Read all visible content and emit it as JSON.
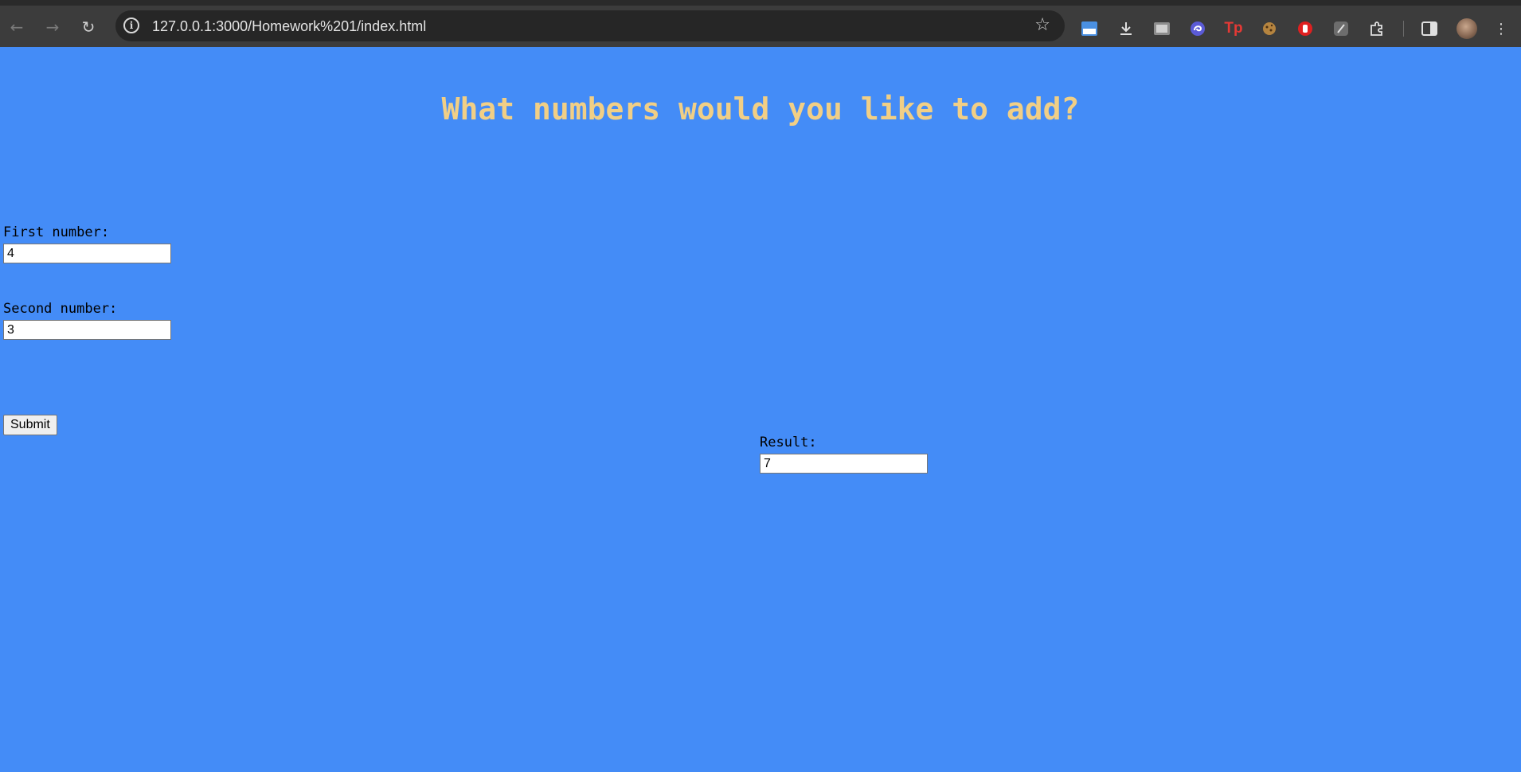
{
  "browser": {
    "url": "127.0.0.1:3000/Homework%201/index.html",
    "back_icon": "arrow-back-icon",
    "forward_icon": "arrow-forward-icon",
    "reload_icon": "reload-icon",
    "info_icon": "info-icon",
    "bookmark_icon": "star-icon",
    "extensions": [
      "extension-app-icon",
      "download-icon",
      "extension-image-icon",
      "extension-swirl-icon",
      "extension-tp-icon",
      "extension-cookie-icon",
      "extension-hand-icon",
      "extension-feather-icon",
      "puzzle-icon",
      "side-panel-icon"
    ],
    "menu_icon": "kebab-menu-icon"
  },
  "page": {
    "background": "#448cf7",
    "heading": "What numbers would you like to add?",
    "heading_color": "#f1cf86",
    "first_label": "First number:",
    "first_value": "4",
    "second_label": "Second number:",
    "second_value": "3",
    "submit_label": "Submit",
    "result_label": "Result:",
    "result_value": "7"
  }
}
